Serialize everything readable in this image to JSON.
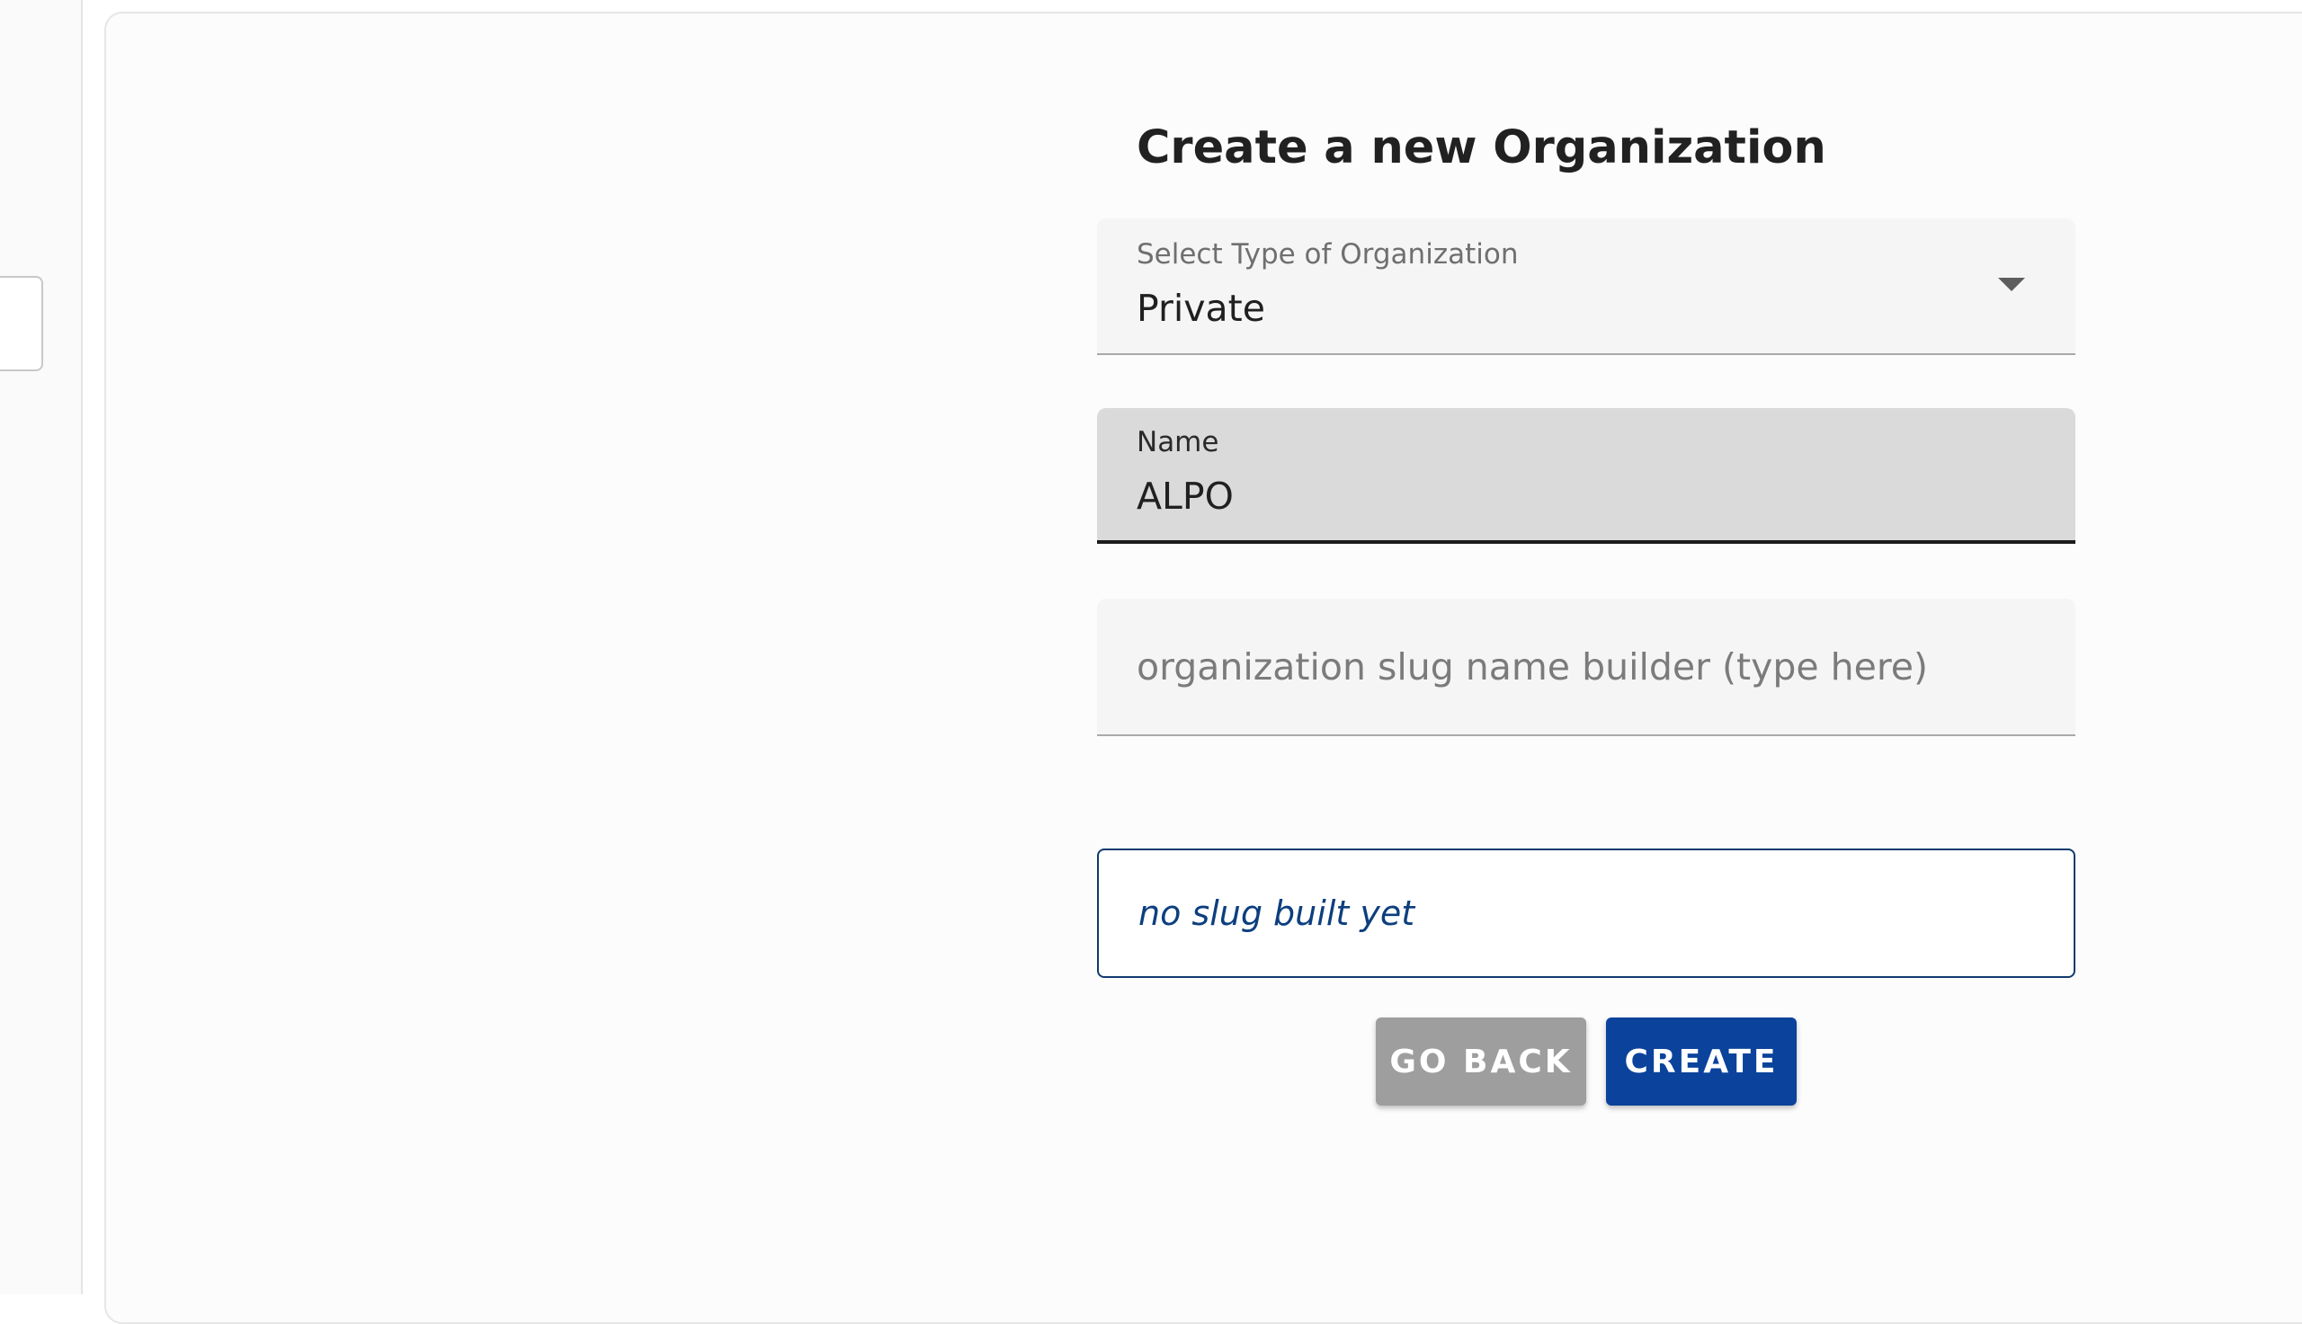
{
  "page": {
    "title": "Create a new Organization"
  },
  "form": {
    "org_type": {
      "label": "Select Type of Organization",
      "value": "Private"
    },
    "name": {
      "label": "Name",
      "value": "ALPO"
    },
    "slug_builder": {
      "placeholder": "organization slug name builder (type here)",
      "value": ""
    },
    "slug_preview": {
      "text": "no slug built yet"
    }
  },
  "actions": {
    "back_label": "GO BACK",
    "create_label": "CREATE"
  },
  "colors": {
    "primary": "#0b429c",
    "secondary_button": "#9e9e9e",
    "preview_border": "#0e3b6e",
    "preview_text": "#0d3f7f"
  },
  "icons": {
    "dropdown": "chevron-down-icon"
  }
}
